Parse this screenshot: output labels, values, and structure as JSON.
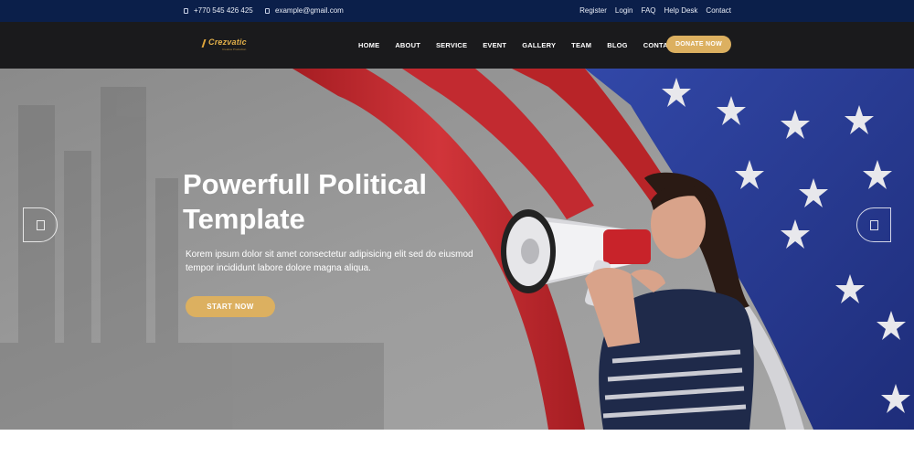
{
  "topbar": {
    "phone": "+770 545 426 425",
    "email": "example@gmail.com",
    "links": [
      "Register",
      "Login",
      "FAQ",
      "Help Desk",
      "Contact"
    ]
  },
  "navbar": {
    "logo_name": "Crezvatic",
    "logo_tagline": "Creative Production",
    "menu": [
      "HOME",
      "ABOUT",
      "SERVICE",
      "EVENT",
      "GALLERY",
      "TEAM",
      "BLOG",
      "CONTACT"
    ],
    "donate_label": "DONATE NOW"
  },
  "hero": {
    "title": "Powerfull Political Template",
    "description": "Korem ipsum dolor sit amet consectetur adipisicing elit sed do eiusmod tempor incididunt labore dolore magna aliqua.",
    "cta_label": "START NOW"
  },
  "colors": {
    "topbar_bg": "#0b1f4a",
    "navbar_bg": "#1a1a1c",
    "accent_gold": "#dcb060",
    "flag_red": "#c0262c",
    "flag_blue": "#2a3f9a"
  },
  "icons": {
    "phone": "phone-icon",
    "email": "envelope-icon",
    "prev": "arrow-left-icon",
    "next": "arrow-right-icon"
  }
}
